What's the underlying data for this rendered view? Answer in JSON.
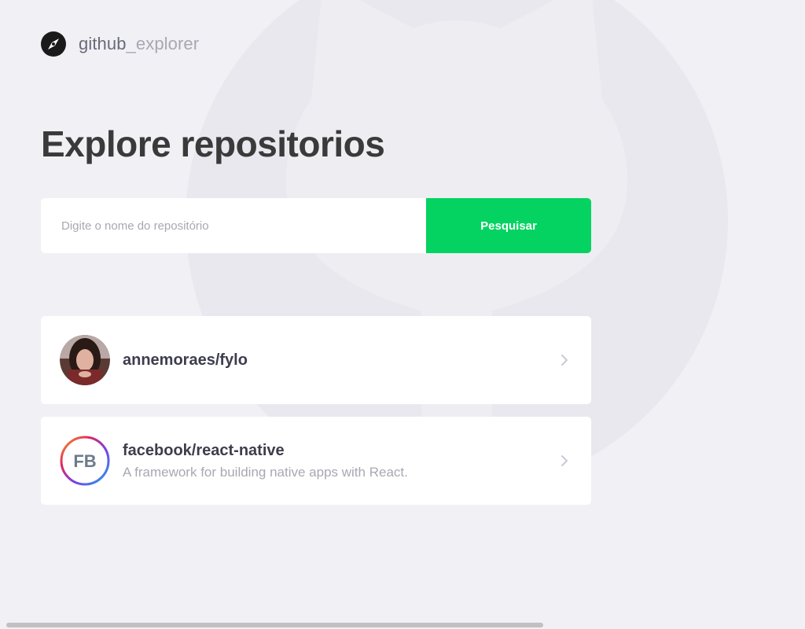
{
  "brand": {
    "main": "github",
    "sub": "_explorer",
    "icon": "compass-icon"
  },
  "page": {
    "title": "Explore repositorios",
    "background_logo": "github-octocat-logo"
  },
  "search": {
    "placeholder": "Digite o nome do repositório",
    "value": "",
    "button_label": "Pesquisar",
    "button_color": "#04d361"
  },
  "repositories": [
    {
      "full_name": "annemoraes/fylo",
      "description": "",
      "avatar": "user-photo-avatar"
    },
    {
      "full_name": "facebook/react-native",
      "description": "A framework for building native apps with React.",
      "avatar": "facebook-logo-avatar",
      "avatar_text": "FB"
    }
  ],
  "colors": {
    "background": "#f0f0f5",
    "title": "#3a3a3a",
    "muted": "#a8a8b3",
    "accent": "#04d361"
  }
}
